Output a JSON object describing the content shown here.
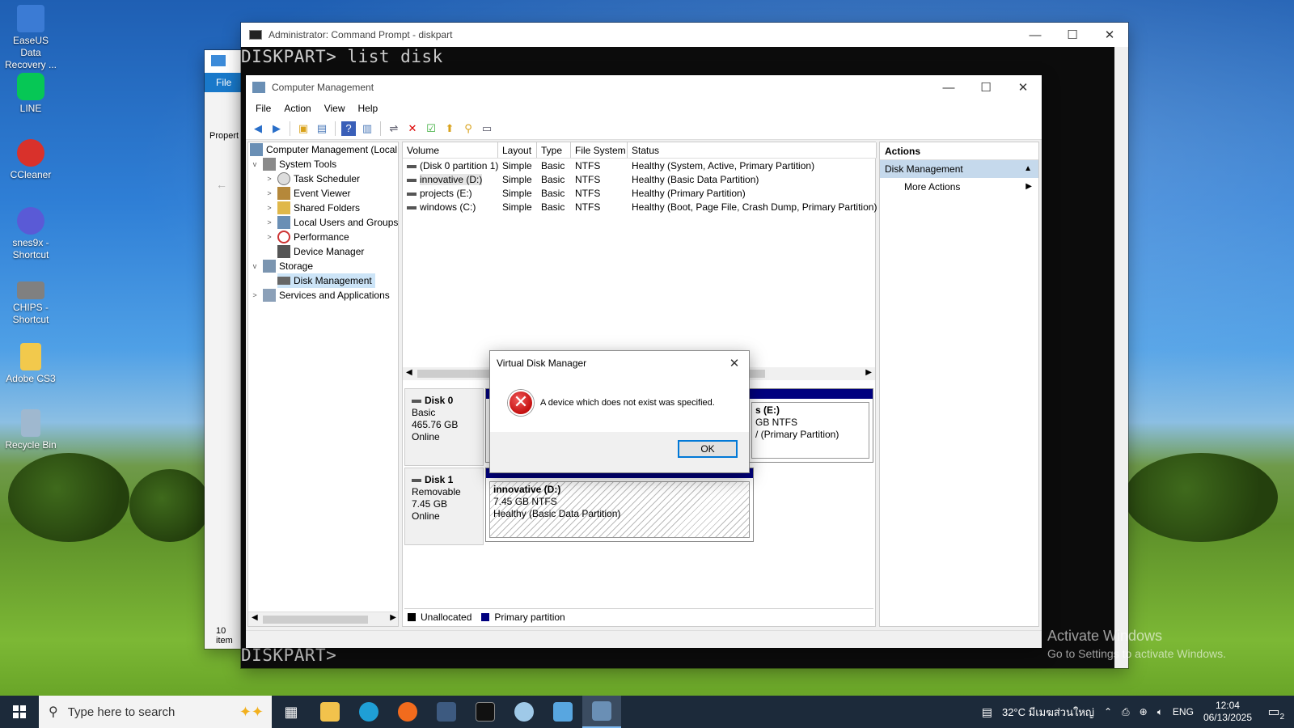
{
  "desktop": {
    "icons": [
      {
        "label": "EaseUS Data Recovery ...",
        "color": "#3b7bd4"
      },
      {
        "label": "LINE",
        "color": "#06c755"
      },
      {
        "label": "CCleaner",
        "color": "#d9312b"
      },
      {
        "label": "snes9x - Shortcut",
        "color": "#5a5ad6"
      },
      {
        "label": "CHIPS - Shortcut",
        "color": "#808080"
      },
      {
        "label": "Adobe CS3",
        "color": "#f2c94c"
      },
      {
        "label": "Recycle Bin",
        "color": "#9fb8cf"
      }
    ]
  },
  "explorer": {
    "menu_file": "File",
    "properties": "Propert",
    "items_count": "10 item"
  },
  "cmd": {
    "title": "Administrator: Command Prompt - diskpart",
    "line1": "DISKPART> list disk",
    "line2": "DISKPART>"
  },
  "cm": {
    "title": "Computer Management",
    "menu": [
      "File",
      "Action",
      "View",
      "Help"
    ],
    "tree": [
      {
        "label": "Computer Management (Local",
        "level": 0,
        "expander": ""
      },
      {
        "label": "System Tools",
        "level": 1,
        "expander": "v"
      },
      {
        "label": "Task Scheduler",
        "level": 2,
        "expander": ">"
      },
      {
        "label": "Event Viewer",
        "level": 2,
        "expander": ">"
      },
      {
        "label": "Shared Folders",
        "level": 2,
        "expander": ">"
      },
      {
        "label": "Local Users and Groups",
        "level": 2,
        "expander": ">"
      },
      {
        "label": "Performance",
        "level": 2,
        "expander": ">"
      },
      {
        "label": "Device Manager",
        "level": 2,
        "expander": ""
      },
      {
        "label": "Storage",
        "level": 1,
        "expander": "v"
      },
      {
        "label": "Disk Management",
        "level": 2,
        "expander": ""
      },
      {
        "label": "Services and Applications",
        "level": 1,
        "expander": ">"
      }
    ],
    "columns": [
      "Volume",
      "Layout",
      "Type",
      "File System",
      "Status"
    ],
    "volumes": [
      {
        "volume": "(Disk 0 partition 1)",
        "layout": "Simple",
        "type": "Basic",
        "fs": "NTFS",
        "status": "Healthy (System, Active, Primary Partition)"
      },
      {
        "volume": "innovative (D:)",
        "layout": "Simple",
        "type": "Basic",
        "fs": "NTFS",
        "status": "Healthy (Basic Data Partition)"
      },
      {
        "volume": "projects (E:)",
        "layout": "Simple",
        "type": "Basic",
        "fs": "NTFS",
        "status": "Healthy (Primary Partition)"
      },
      {
        "volume": "windows (C:)",
        "layout": "Simple",
        "type": "Basic",
        "fs": "NTFS",
        "status": "Healthy (Boot, Page File, Crash Dump, Primary Partition)"
      }
    ],
    "disk0": {
      "name": "Disk 0",
      "type": "Basic",
      "size": "465.76 GB",
      "state": "Online",
      "part_name": "s  (E:)",
      "part_size": "GB NTFS",
      "part_status": "/ (Primary Partition)"
    },
    "disk1": {
      "name": "Disk 1",
      "type": "Removable",
      "size": "7.45 GB",
      "state": "Online",
      "part_name": "innovative  (D:)",
      "part_size": "7.45 GB NTFS",
      "part_status": "Healthy (Basic Data Partition)"
    },
    "legend": {
      "unallocated": "Unallocated",
      "primary": "Primary partition",
      "unallocated_color": "#000000",
      "primary_color": "#00007f"
    },
    "actions": {
      "header": "Actions",
      "section": "Disk Management",
      "more": "More Actions"
    }
  },
  "dialog": {
    "title": "Virtual Disk Manager",
    "message": "A device which does not exist was specified.",
    "ok": "OK"
  },
  "watermark": {
    "line1": "Activate Windows",
    "line2": "Go to Settings to activate Windows."
  },
  "taskbar": {
    "search_placeholder": "Type here to search",
    "weather": "32°C  มีเมฆส่วนใหญ่",
    "lang": "ENG",
    "time": "12:04",
    "date": "06/13/2025",
    "notif_count": "2"
  }
}
